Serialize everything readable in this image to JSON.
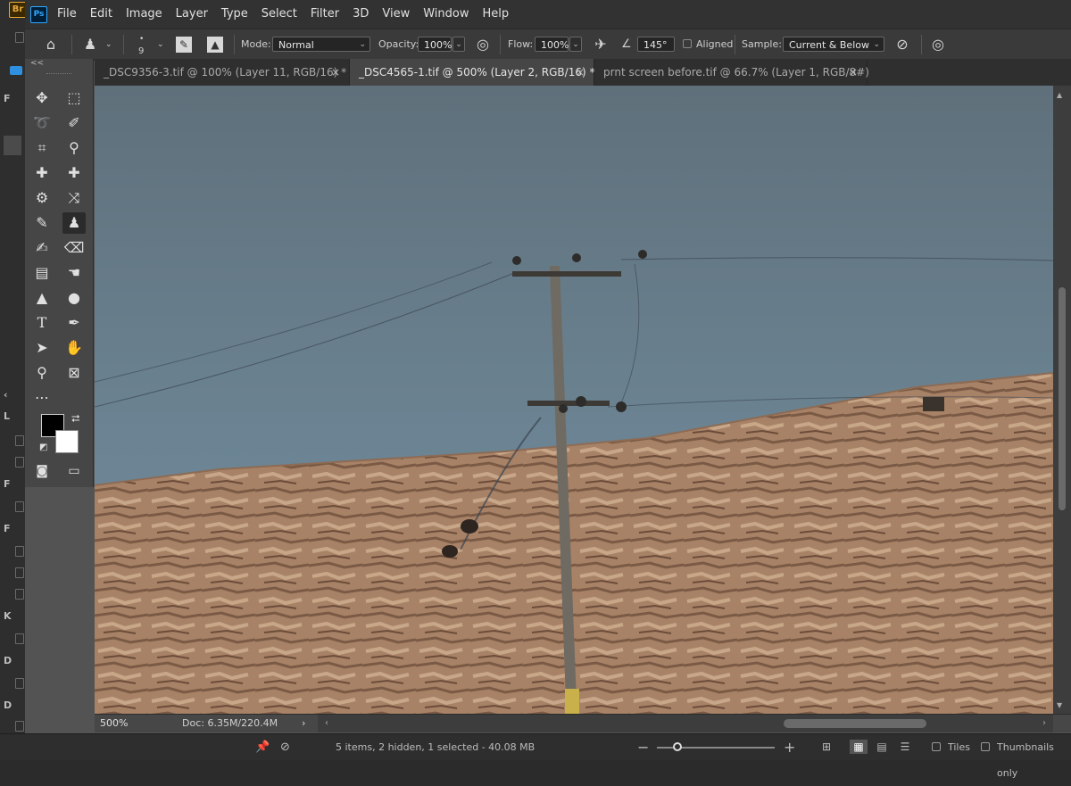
{
  "bridge": {
    "logo_text": "Br",
    "sidebar_letters": [
      "F",
      "L",
      "F",
      "F",
      "K",
      "D",
      "D"
    ],
    "status_text": "5 items, 2 hidden, 1 selected - 40.08 MB",
    "zoom_minus": "−",
    "zoom_plus": "+",
    "tiles_label": "Tiles",
    "thumbnails_only_label": "Thumbnails only",
    "pin_icon": "pin-icon",
    "filter_icon": "no-entry-icon"
  },
  "photoshop": {
    "logo_text": "Ps",
    "menu": [
      "File",
      "Edit",
      "Image",
      "Layer",
      "Type",
      "Select",
      "Filter",
      "3D",
      "View",
      "Window",
      "Help"
    ],
    "options": {
      "brush_size": "9",
      "mode_label": "Mode:",
      "mode_value": "Normal",
      "opacity_label": "Opacity:",
      "opacity_value": "100%",
      "flow_label": "Flow:",
      "flow_value": "100%",
      "angle_value": "145°",
      "aligned_label": "Aligned",
      "sample_label": "Sample:",
      "sample_value": "Current & Below"
    },
    "tabs": [
      {
        "label": "_DSC9356-3.tif @ 100% (Layer 11, RGB/16) *",
        "active": false
      },
      {
        "label": "_DSC4565-1.tif @ 500% (Layer 2, RGB/16) *",
        "active": true
      },
      {
        "label": "prnt screen before.tif @ 66.7% (Layer 1, RGB/8#)",
        "active": false
      }
    ],
    "tab_close_glyph": "×",
    "toolbox_collapse": "<<",
    "status": {
      "zoom": "500%",
      "doc_info": "Doc: 6.35M/220.4M",
      "arrow": "›"
    },
    "colors": {
      "foreground": "#000000",
      "background": "#ffffff",
      "sky": "#6f8797",
      "hill": "#a98366",
      "pole": "#6f6a62"
    }
  }
}
